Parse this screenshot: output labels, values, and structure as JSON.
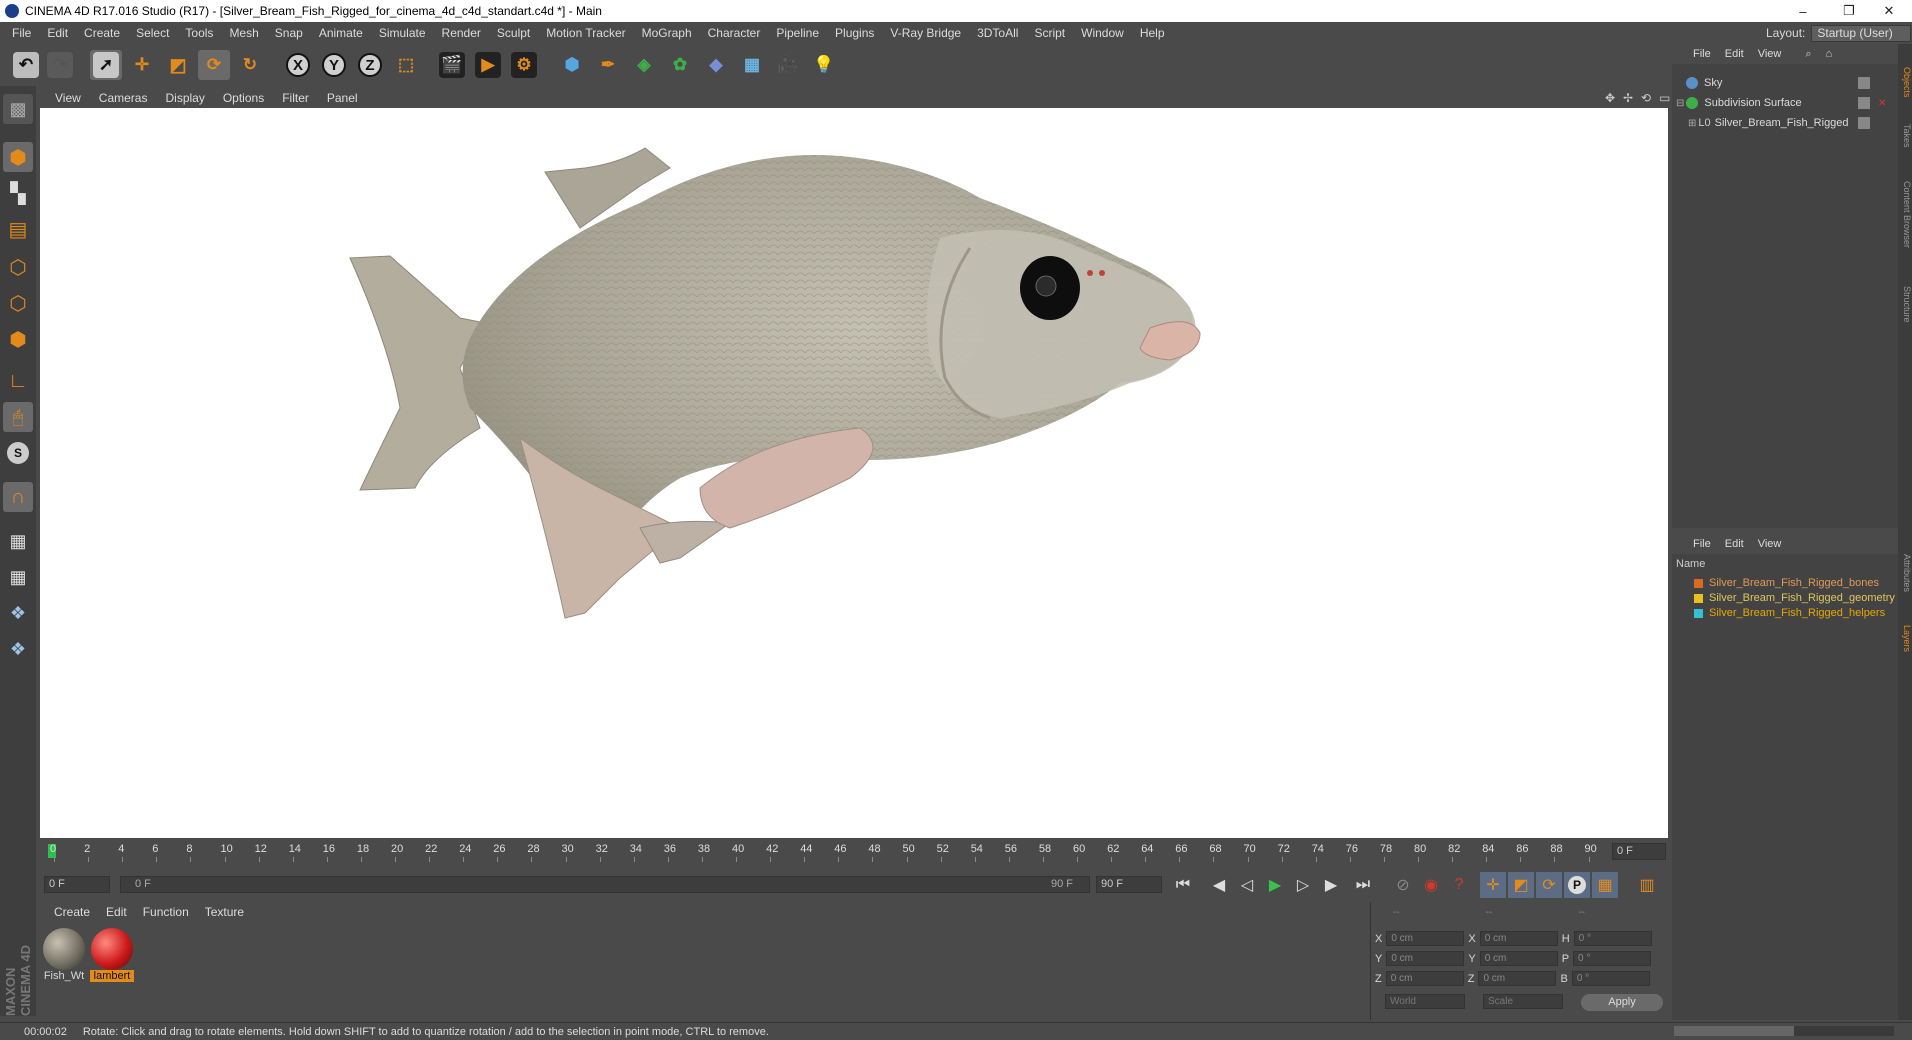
{
  "titlebar": {
    "title": "CINEMA 4D R17.016 Studio (R17) - [Silver_Bream_Fish_Rigged_for_cinema_4d_c4d_standart.c4d *] - Main",
    "minimize": "–",
    "restore": "❐",
    "close": "✕"
  },
  "menubar": [
    "File",
    "Edit",
    "Create",
    "Select",
    "Tools",
    "Mesh",
    "Snap",
    "Animate",
    "Simulate",
    "Render",
    "Sculpt",
    "Motion Tracker",
    "MoGraph",
    "Character",
    "Pipeline",
    "Plugins",
    "V-Ray Bridge",
    "3DToAll",
    "Script",
    "Window",
    "Help"
  ],
  "layout": {
    "label": "Layout:",
    "value": "Startup (User)"
  },
  "viewport_menu": [
    "View",
    "Cameras",
    "Display",
    "Options",
    "Filter",
    "Panel"
  ],
  "timeline": {
    "ticks": [
      "0",
      "2",
      "4",
      "6",
      "8",
      "10",
      "12",
      "14",
      "16",
      "18",
      "20",
      "22",
      "24",
      "26",
      "28",
      "30",
      "32",
      "34",
      "36",
      "38",
      "40",
      "42",
      "44",
      "46",
      "48",
      "50",
      "52",
      "54",
      "56",
      "58",
      "60",
      "62",
      "64",
      "66",
      "68",
      "70",
      "72",
      "74",
      "76",
      "78",
      "80",
      "82",
      "84",
      "86",
      "88",
      "90"
    ],
    "current_frame": "0 F"
  },
  "anim": {
    "start": "0 F",
    "range_start": "0 F",
    "range_end": "90 F",
    "end": "90 F"
  },
  "materials": {
    "menu": [
      "Create",
      "Edit",
      "Function",
      "Texture"
    ],
    "items": [
      {
        "name": "Fish_Wt",
        "color": "#7a7468"
      },
      {
        "name": "lambert",
        "color": "#cc1a1a"
      }
    ]
  },
  "coords": {
    "header": [
      "--",
      "--",
      "--"
    ],
    "rows": [
      {
        "a": "X",
        "av": "0 cm",
        "b": "X",
        "bv": "0 cm",
        "c": "H",
        "cv": "0 °"
      },
      {
        "a": "Y",
        "av": "0 cm",
        "b": "Y",
        "bv": "0 cm",
        "c": "P",
        "cv": "0 °"
      },
      {
        "a": "Z",
        "av": "0 cm",
        "b": "Z",
        "bv": "0 cm",
        "c": "B",
        "cv": "0 °"
      }
    ],
    "world": "World",
    "scale": "Scale",
    "apply": "Apply"
  },
  "object_manager": {
    "menu": [
      "File",
      "Edit",
      "View"
    ],
    "objects": [
      {
        "name": "Sky",
        "icon_color": "#5a8fc9"
      },
      {
        "name": "Subdivision Surface",
        "icon_color": "#3fae4a"
      },
      {
        "name": "Silver_Bream_Fish_Rigged",
        "icon_color": "#bbbbbb"
      }
    ]
  },
  "layer_manager": {
    "menu": [
      "File",
      "Edit",
      "View"
    ],
    "header": "Name",
    "layers": [
      {
        "name": "Silver_Bream_Fish_Rigged_bones",
        "color": "#d86b1f"
      },
      {
        "name": "Silver_Bream_Fish_Rigged_geometry",
        "color": "#e6c21c"
      },
      {
        "name": "Silver_Bream_Fish_Rigged_helpers",
        "color": "#33c0d0"
      }
    ]
  },
  "side_tabs": [
    "Objects",
    "Takes",
    "Content Browser",
    "Structure",
    "Attributes",
    "Layers"
  ],
  "status": {
    "time": "00:00:02",
    "message": "Rotate: Click and drag to rotate elements. Hold down SHIFT to add to quantize rotation / add to the selection in point mode, CTRL to remove."
  },
  "brand": "MAXON CINEMA 4D"
}
